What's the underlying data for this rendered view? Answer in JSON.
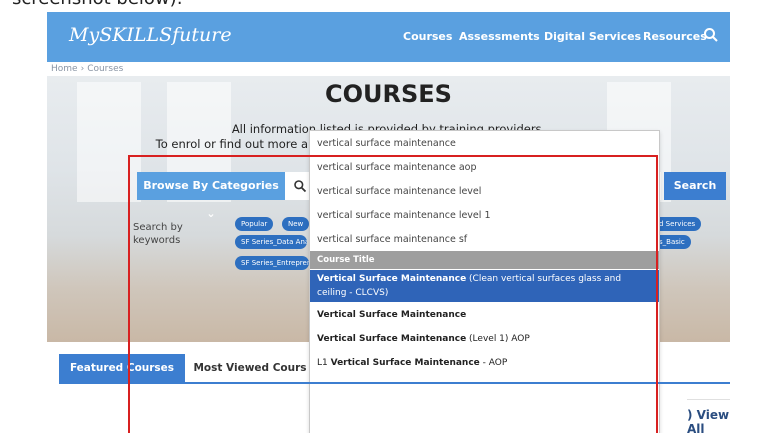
{
  "caption": "screenshot below):",
  "nav": {
    "logo": "MySKILLSfuture",
    "items": [
      "Courses",
      "Assessments",
      "Digital Services",
      "Resources"
    ],
    "search_icon": "search-icon"
  },
  "breadcrumb": {
    "home": "Home",
    "current": "Courses"
  },
  "hero": {
    "title": "COURSES",
    "line1": "All information listed is provided by training providers.",
    "line2": "To enrol or find out more about the courses, please contact the training provider."
  },
  "search": {
    "browse_label": "Browse By Categories  ⌄",
    "query": "vertical surface maintenance",
    "button_label": "Search"
  },
  "keywords": {
    "label_line1": "Search by",
    "label_line2": "keywords",
    "tags_row1": [
      "Popular",
      "New",
      "d Services"
    ],
    "tags_row2": [
      "SF Series_Data Anal",
      "s_Basic"
    ],
    "tags_row3": [
      "SF Series_Entreprer"
    ]
  },
  "dropdown": {
    "suggestions": [
      "vertical surface maintenance",
      "vertical surface maintenance aop",
      "vertical surface maintenance level",
      "vertical surface maintenance level 1",
      "vertical surface maintenance sf"
    ],
    "group_label": "Course Title",
    "results": [
      {
        "bold": "Vertical Surface Maintenance",
        "rest": " (Clean vertical surfaces glass and ceiling - CLCVS)"
      },
      {
        "bold": "Vertical Surface Maintenance",
        "rest": ""
      },
      {
        "bold": "Vertical Surface Maintenance",
        "rest": " (Level 1) AOP"
      },
      {
        "prefix": "L1 ",
        "bold": "Vertical Surface Maintenance",
        "rest": " - AOP"
      }
    ]
  },
  "tabs": [
    "Featured Courses",
    "Most Viewed Cours"
  ],
  "view_all": ") View All",
  "colors": {
    "nav_blue": "#5aa0e0",
    "button_blue": "#3c7ed0",
    "selected_row": "#2f64b8",
    "highlight_box": "#d82020"
  }
}
